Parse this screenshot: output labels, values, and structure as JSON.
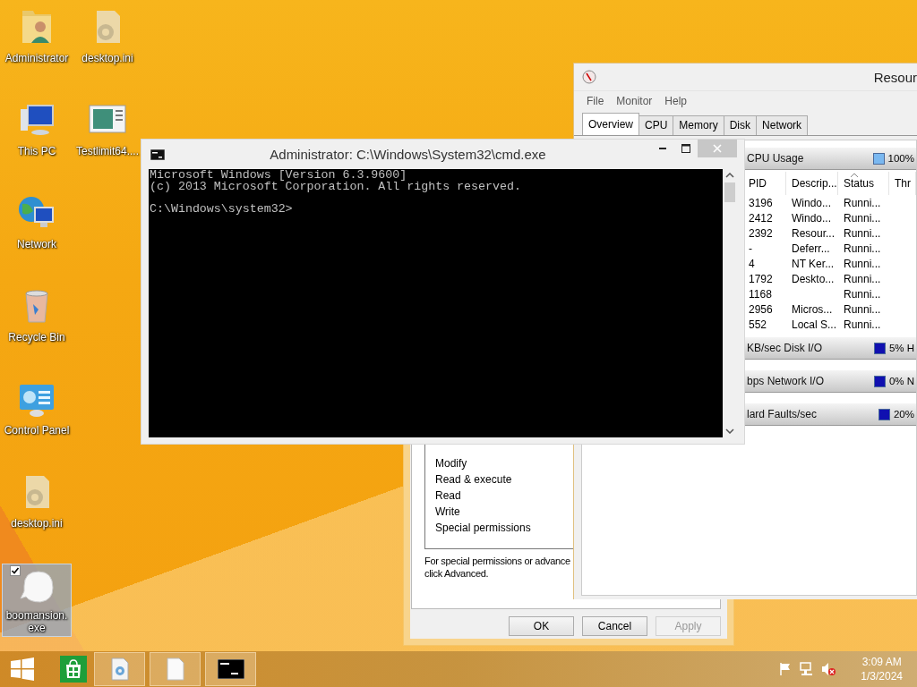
{
  "desktop_icons": [
    {
      "label": "Administrator",
      "kind": "user-folder",
      "selected": false
    },
    {
      "label": "desktop.ini",
      "kind": "settings-file",
      "selected": false
    },
    {
      "label": "This PC",
      "kind": "computer",
      "selected": false
    },
    {
      "label": "Testlimit64....",
      "kind": "app-window",
      "selected": false
    },
    {
      "label": "Network",
      "kind": "network",
      "selected": false
    },
    {
      "label": "Recycle Bin",
      "kind": "recycle-bin",
      "selected": false
    },
    {
      "label": "Control Panel",
      "kind": "control-panel",
      "selected": false
    },
    {
      "label": "desktop.ini",
      "kind": "settings-file",
      "selected": false
    },
    {
      "label": "boomansion.exe",
      "kind": "ghost",
      "selected": true
    }
  ],
  "resource_monitor": {
    "title": "Resour",
    "menu": [
      "File",
      "Monitor",
      "Help"
    ],
    "tabs": [
      {
        "label": "Overview",
        "selected": true
      },
      {
        "label": "CPU",
        "selected": false
      },
      {
        "label": "Memory",
        "selected": false
      },
      {
        "label": "Disk",
        "selected": false
      },
      {
        "label": "Network",
        "selected": false
      }
    ],
    "cpu_panel": {
      "title": "CPU Usage",
      "reading": "100%"
    },
    "columns": [
      {
        "label": "PID",
        "sorted": false
      },
      {
        "label": "Descrip...",
        "sorted": false
      },
      {
        "label": "Status",
        "sorted": true
      },
      {
        "label": "Thr",
        "sorted": false
      }
    ],
    "rows": [
      {
        "pid": "3196",
        "description": "Windo...",
        "status": "Runni..."
      },
      {
        "pid": "2412",
        "description": "Windo...",
        "status": "Runni..."
      },
      {
        "pid": "2392",
        "description": "Resour...",
        "status": "Runni..."
      },
      {
        "pid": "-",
        "description": "Deferr...",
        "status": "Runni..."
      },
      {
        "pid": "4",
        "description": "NT Ker...",
        "status": "Runni..."
      },
      {
        "pid": "1792",
        "description": "Deskto...",
        "status": "Runni..."
      },
      {
        "pid": "1168",
        "status": "Runni..."
      },
      {
        "pid": "2956",
        "description": "Micros...",
        "status": "Runni..."
      },
      {
        "pid": "552",
        "description": "Local S...",
        "status": "Runni..."
      }
    ],
    "panels": [
      {
        "title": "KB/sec Disk I/O",
        "reading": "5% H"
      },
      {
        "title": "bps Network I/O",
        "reading": "0% N"
      },
      {
        "title": "lard Faults/sec",
        "reading": "20%"
      }
    ]
  },
  "console": {
    "title": "Administrator: C:\\Windows\\System32\\cmd.exe",
    "output": [
      "Microsoft Windows [Version 6.3.9600]",
      "(c) 2013 Microsoft Corporation. All rights reserved."
    ],
    "prompt": "C:\\Windows\\system32>"
  },
  "permissions_dialog": {
    "permissions": [
      "Modify",
      "Read & execute",
      "Read",
      "Write",
      "Special permissions"
    ],
    "note": "For special permissions or advance\nclick Advanced.",
    "buttons": [
      {
        "label": "OK",
        "disabled": false
      },
      {
        "label": "Cancel",
        "disabled": false
      },
      {
        "label": "Apply",
        "disabled": true
      }
    ]
  },
  "taskbar": {
    "time": "3:09 AM",
    "date": "1/3/2024"
  }
}
